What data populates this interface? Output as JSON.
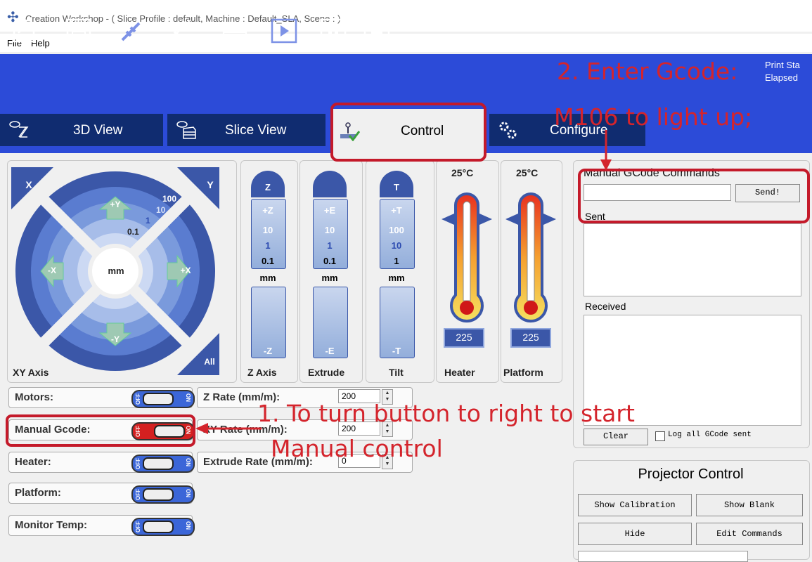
{
  "window": {
    "title": "Creation Workshop -  ( Slice Profile : default, Machine : Default_SLA, Scene : )"
  },
  "menu": [
    {
      "label": "File"
    },
    {
      "label": "Help"
    }
  ],
  "toolbar": {
    "icons": [
      "open-icon",
      "save-icon",
      "disconnect-icon",
      "connect-icon",
      "slice-icon",
      "play-icon",
      "pause-icon",
      "stop-icon"
    ],
    "status_line1": "Print Sta",
    "status_line2": "Elapsed"
  },
  "tabs": [
    {
      "label": "3D View",
      "icon": "eye-hourglass-icon"
    },
    {
      "label": "Slice View",
      "icon": "eye-layers-icon"
    },
    {
      "label": "Control",
      "icon": "joystick-icon"
    },
    {
      "label": "Configure",
      "icon": "gears-icon"
    }
  ],
  "xy": {
    "label": "XY Axis",
    "x": "X",
    "y": "Y",
    "all": "All",
    "plus_y": "+Y",
    "minus_y": "-Y",
    "plus_x": "+X",
    "minus_x": "-X",
    "center": "mm",
    "step_100": "100",
    "step_10": "10",
    "step_1": "1",
    "step_01": "0.1"
  },
  "z": {
    "label": "Z Axis",
    "top": "Z",
    "plus": "+Z",
    "minus": "-Z",
    "s10": "10",
    "s1": "1",
    "s01": "0.1",
    "unit": "mm"
  },
  "extrude": {
    "label": "Extrude",
    "plus": "+E",
    "minus": "-E",
    "s10": "10",
    "s1": "1",
    "s01": "0.1",
    "unit": "mm"
  },
  "tilt": {
    "label": "Tilt",
    "top": "T",
    "plus": "+T",
    "minus": "-T",
    "s100": "100",
    "s10": "10",
    "s1": "1",
    "unit": "mm"
  },
  "heater": {
    "label": "Heater",
    "temp": "25°C",
    "set": "225"
  },
  "platform": {
    "label": "Platform",
    "temp": "25°C",
    "set": "225"
  },
  "toggles": [
    {
      "label": "Motors:",
      "on": false
    },
    {
      "label": "Manual Gcode:",
      "on": true
    },
    {
      "label": "Heater:",
      "on": false
    },
    {
      "label": "Platform:",
      "on": false
    },
    {
      "label": "Monitor Temp:",
      "on": false
    }
  ],
  "switch_text": {
    "off": "OFF",
    "on": "ON"
  },
  "rates": [
    {
      "label": "Z Rate (mm/m):",
      "value": "200"
    },
    {
      "label": "XY Rate (mm/m):",
      "value": "200"
    },
    {
      "label": "Extrude Rate (mm/m):",
      "value": "0"
    }
  ],
  "gcode": {
    "title": "Manual GCode Commands",
    "input_value": "",
    "send": "Send!",
    "sent_label": "Sent",
    "received_label": "Received",
    "clear": "Clear",
    "log_label": "Log all GCode sent"
  },
  "projector": {
    "title": "Projector Control",
    "show_calibration": "Show Calibration",
    "show_blank": "Show Blank",
    "hide": "Hide",
    "edit": "Edit Commands"
  },
  "annotations": {
    "a2_line1": "2. Enter Gcode:",
    "a2_line2": "M106 to light up;",
    "a1_line1": "1. To turn button to right to start",
    "a1_line2": "Manual control"
  },
  "colors": {
    "toolbar": "#2c4bd8",
    "tab": "#102c70",
    "accent": "#3b66d8",
    "annotation": "#d4242c"
  }
}
